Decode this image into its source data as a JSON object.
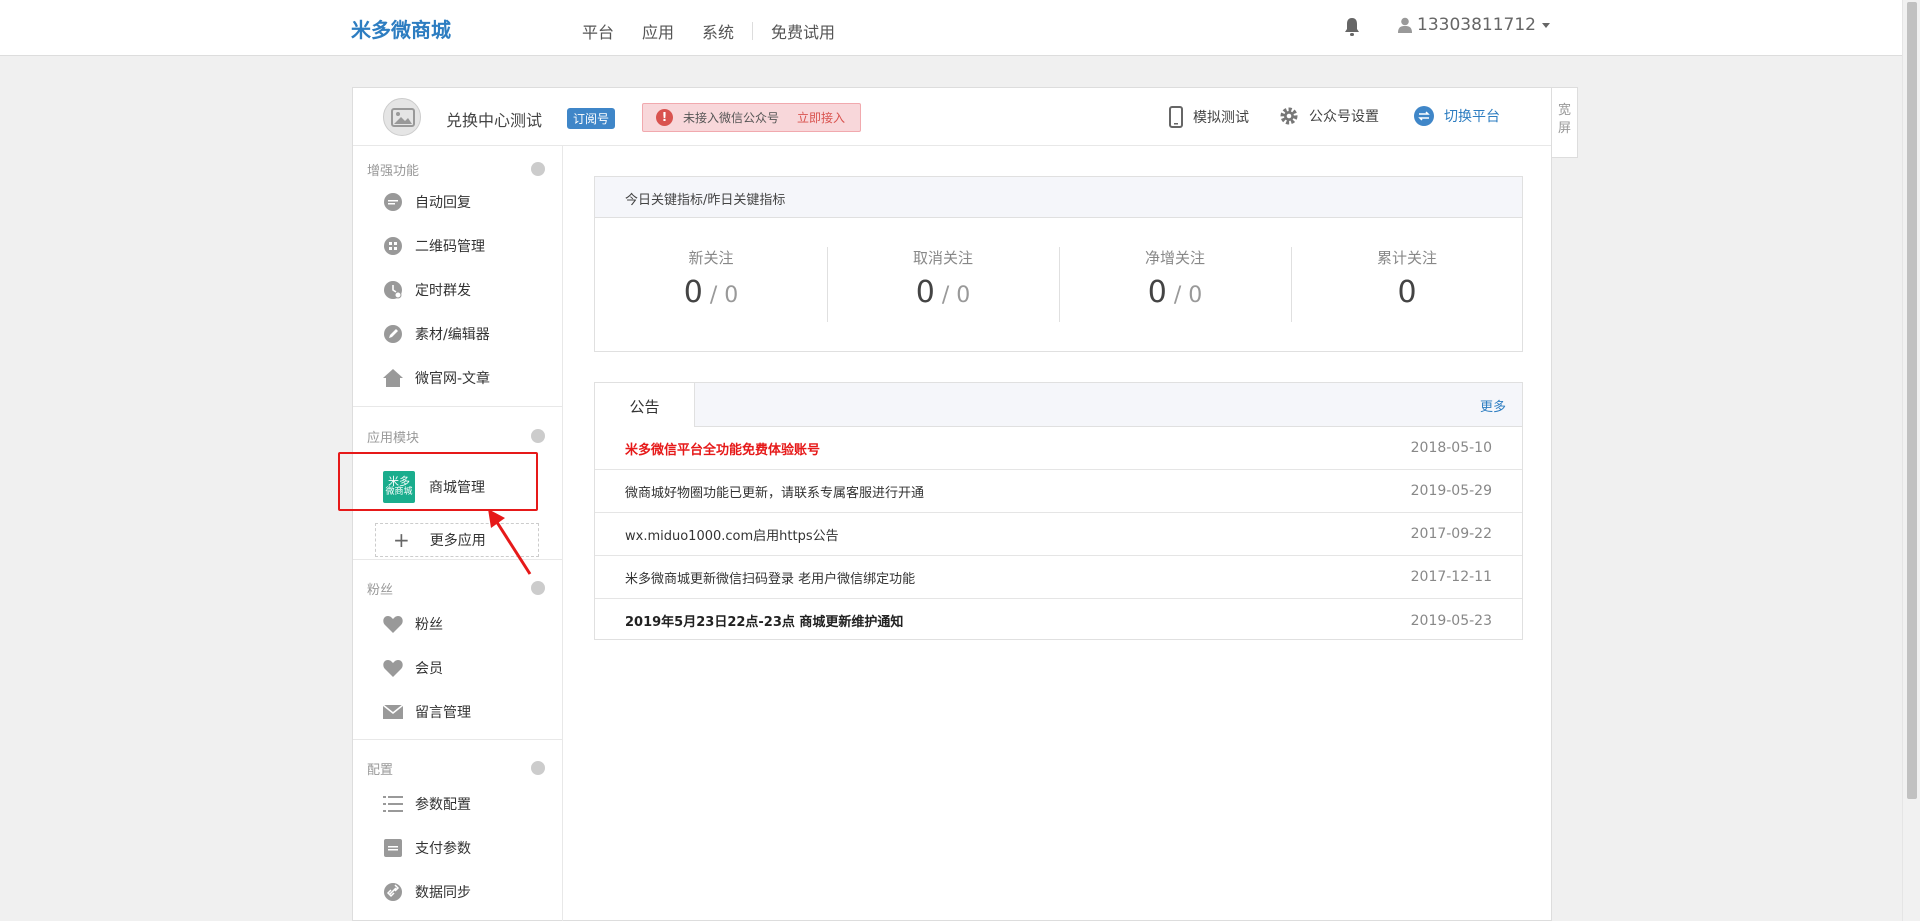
{
  "brand": "米多微商城",
  "nav": [
    "平台",
    "应用",
    "系统",
    "免费试用"
  ],
  "user": {
    "phone": "13303811712"
  },
  "wide_screen_label": "宽屏",
  "account": {
    "name": "兑换中心测试",
    "badge": "订阅号",
    "warning_text": "未接入微信公众号",
    "warning_link": "立即接入"
  },
  "tools": {
    "simulate": "模拟测试",
    "settings": "公众号设置",
    "switch": "切换平台"
  },
  "sidebar": {
    "sections": [
      {
        "title": "增强功能",
        "items": [
          "自动回复",
          "二维码管理",
          "定时群发",
          "素材/编辑器",
          "微官网-文章"
        ]
      },
      {
        "title": "应用模块",
        "app": {
          "logo_top": "米多",
          "logo_bottom": "微商城",
          "label": "商城管理"
        },
        "more": "更多应用"
      },
      {
        "title": "粉丝",
        "items": [
          "粉丝",
          "会员",
          "留言管理"
        ]
      },
      {
        "title": "配置",
        "items": [
          "参数配置",
          "支付参数",
          "数据同步"
        ]
      }
    ]
  },
  "metrics": {
    "header": "今日关键指标/昨日关键指标",
    "items": [
      {
        "label": "新关注",
        "today": "0",
        "yesterday": "0"
      },
      {
        "label": "取消关注",
        "today": "0",
        "yesterday": "0"
      },
      {
        "label": "净增关注",
        "today": "0",
        "yesterday": "0"
      },
      {
        "label": "累计关注",
        "today": "0"
      }
    ]
  },
  "notices": {
    "tab": "公告",
    "more": "更多",
    "rows": [
      {
        "title": "米多微信平台全功能免费体验账号",
        "date": "2018-05-10"
      },
      {
        "title": "微商城好物圈功能已更新，请联系专属客服进行开通",
        "date": "2019-05-29"
      },
      {
        "title": "wx.miduo1000.com启用https公告",
        "date": "2017-09-22"
      },
      {
        "title": "米多微商城更新微信扫码登录 老用户微信绑定功能",
        "date": "2017-12-11"
      },
      {
        "title": "2019年5月23日22点-23点 商城更新维护通知",
        "date": "2019-05-23"
      }
    ]
  },
  "colors": {
    "brand_blue": "#2d7dc1",
    "alert_red": "#e61919",
    "app_green": "#1aad8d"
  }
}
